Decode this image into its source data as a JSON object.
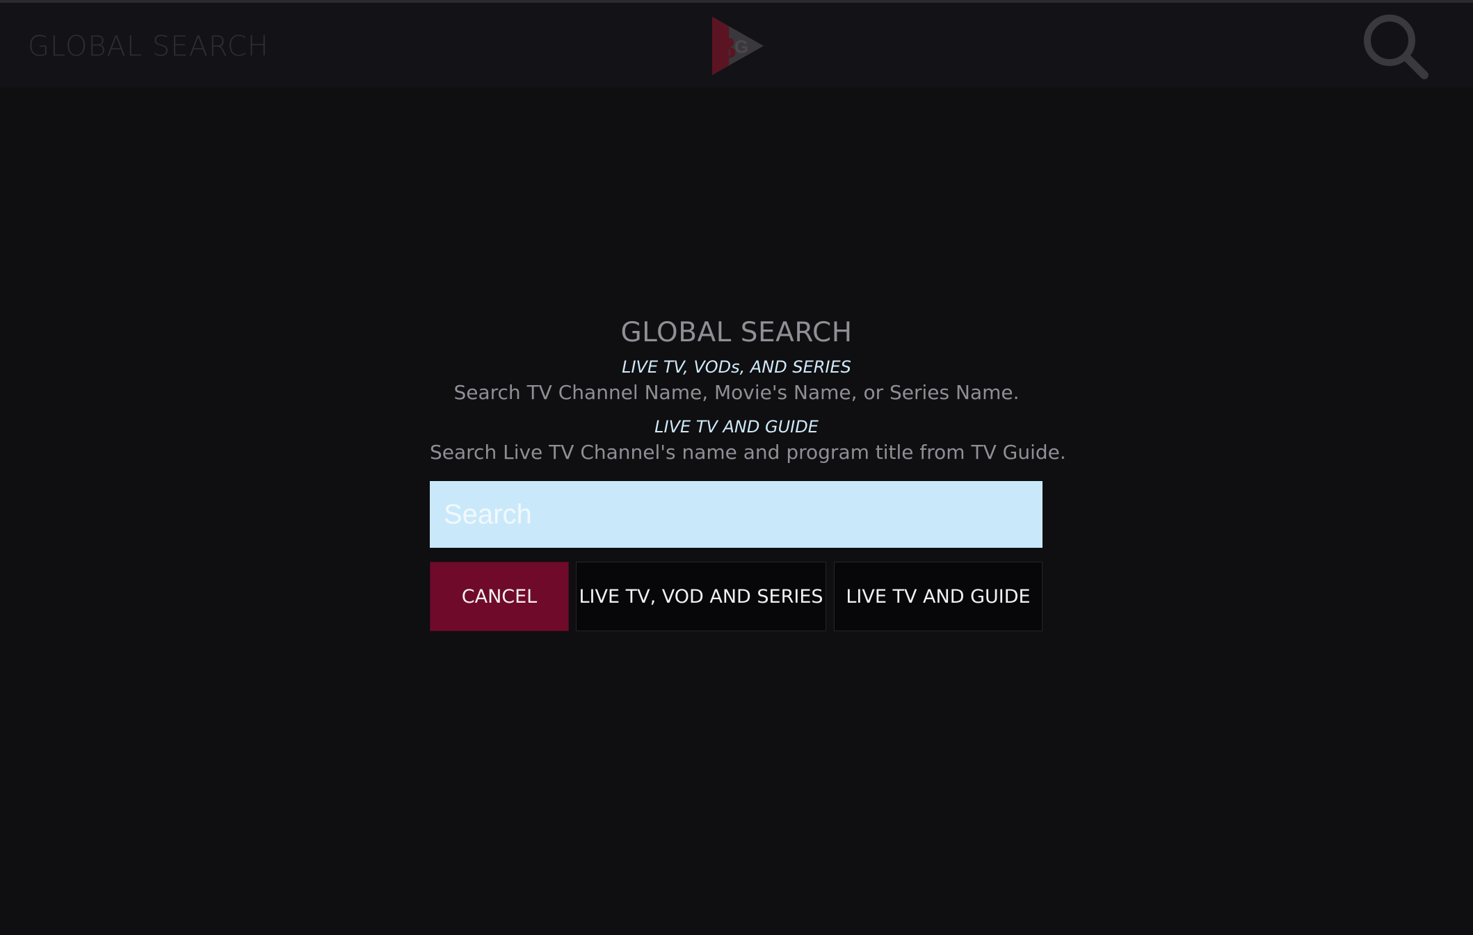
{
  "header": {
    "title": "GLOBAL SEARCH",
    "logo_icon": "big-play-logo-icon",
    "search_icon": "search-icon"
  },
  "dialog": {
    "title": "GLOBAL SEARCH",
    "section1": {
      "heading": "LIVE TV, VODs, AND SERIES",
      "description": "Search TV Channel Name, Movie's Name, or Series Name."
    },
    "section2": {
      "heading": "LIVE TV AND GUIDE",
      "description": "Search Live TV Channel's name and program title from TV Guide."
    },
    "search": {
      "placeholder": "Search",
      "value": ""
    },
    "buttons": {
      "cancel": "CANCEL",
      "vod": "LIVE TV, VOD AND SERIES",
      "guide": "LIVE TV AND GUIDE"
    }
  },
  "colors": {
    "background": "#0f0e11",
    "header": "#131216",
    "accent": "#700a2a",
    "search_field": "#c9e9fa",
    "section_heading": "#cfeaf9",
    "muted_text": "#8f8f96"
  }
}
